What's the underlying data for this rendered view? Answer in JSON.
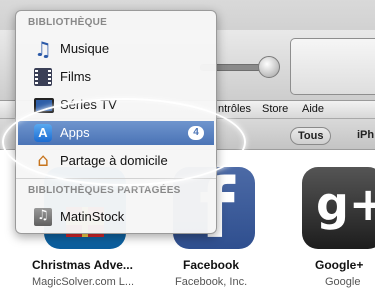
{
  "menubar": {
    "items": [
      "ntrôles",
      "Store",
      "Aide"
    ]
  },
  "filterbar": {
    "items": [
      "Tous",
      "iPh"
    ]
  },
  "popover": {
    "library_header": "BIBLIOTHÈQUE",
    "items": [
      {
        "label": "Musique",
        "icon": "music-note-icon"
      },
      {
        "label": "Films",
        "icon": "film-icon"
      },
      {
        "label": "Séries TV",
        "icon": "tv-icon"
      },
      {
        "label": "Apps",
        "icon": "app-store-icon",
        "badge": "4",
        "selected": true
      },
      {
        "label": "Partage à domicile",
        "icon": "home-icon"
      }
    ],
    "shared_header": "BIBLIOTHÈQUES PARTAGÉES",
    "shared_items": [
      {
        "label": "MatinStock",
        "icon": "shared-library-icon"
      }
    ]
  },
  "apps": [
    {
      "name": "Christmas Adve...",
      "developer": "MagicSolver.com L..."
    },
    {
      "name": "Facebook",
      "developer": "Facebook, Inc."
    },
    {
      "name": "Google+",
      "developer": "Google"
    }
  ],
  "colors": {
    "selection": "#4a73b5",
    "highlight_ring": "#ffffff"
  }
}
